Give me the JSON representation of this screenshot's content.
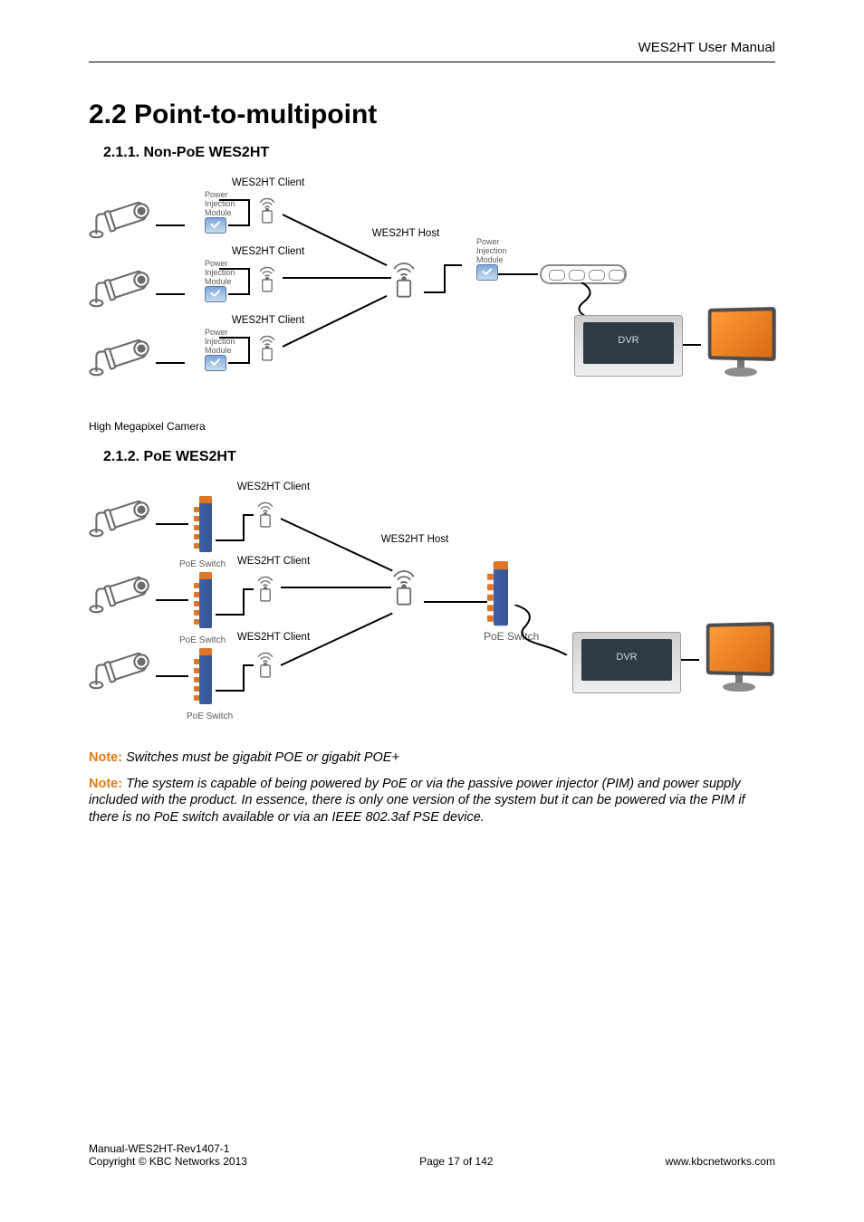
{
  "header": {
    "doc_title": "WES2HT User Manual"
  },
  "section": {
    "h2": "2.2 Point-to-multipoint",
    "h3_a": "2.1.1. Non-PoE WES2HT",
    "h3_b": "2.1.2. PoE WES2HT"
  },
  "diagram1": {
    "client_label_1": "WES2HT Client",
    "client_label_2": "WES2HT Client",
    "client_label_3": "WES2HT Client",
    "host_label": "WES2HT Host",
    "pim_label": "Power\nInjection\nModule",
    "pim_label_host": "Power\nInjection\nModule",
    "dvr_label": "DVR",
    "caption": "High Megapixel Camera"
  },
  "diagram2": {
    "client_label_1": "WES2HT Client",
    "client_label_2": "WES2HT Client",
    "client_label_3": "WES2HT Client",
    "host_label": "WES2HT Host",
    "poe_switch_label": "PoE Switch",
    "poe_switch_label_right": "PoE Switch",
    "dvr_label": "DVR"
  },
  "notes": {
    "note_label": "Note:",
    "note1": "Switches must be gigabit POE or gigabit POE+",
    "note2": "The system is capable of being powered by PoE or via the passive power injector (PIM) and power supply included with the product. In essence, there is only one version of the system but it can be powered via the PIM if there is no PoE switch available or via an IEEE 802.3af PSE device."
  },
  "footer": {
    "left_line1": "Manual-WES2HT-Rev1407-1",
    "left_line2": "Copyright © KBC Networks 2013",
    "center": "Page 17 of 142",
    "right": "www.kbcnetworks.com"
  }
}
